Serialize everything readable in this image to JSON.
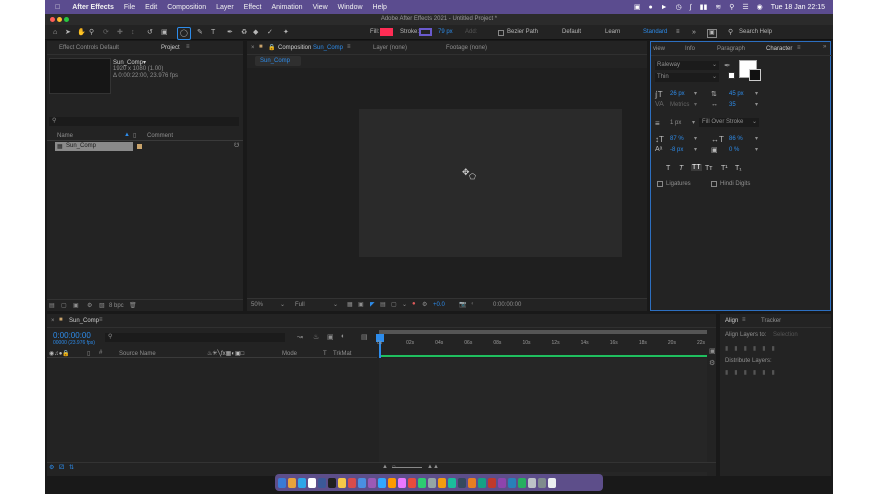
{
  "menubar": {
    "app": "After Effects",
    "items": [
      "File",
      "Edit",
      "Composition",
      "Layer",
      "Effect",
      "Animation",
      "View",
      "Window",
      "Help"
    ],
    "clock": "Tue 18 Jan  22:15"
  },
  "window": {
    "title": "Adobe After Effects 2021 - Untitled Project *"
  },
  "toolbar": {
    "fill_label": "Fill:",
    "fill_color": "#ff2d55",
    "stroke_label": "Stroke:",
    "stroke_color": "#6a5acd",
    "stroke_width": "79 px",
    "add_label": "Add:",
    "bezier_label": "Bezier Path",
    "workspaces": [
      "Default",
      "Learn",
      "Standard"
    ],
    "search_help": "Search Help"
  },
  "project": {
    "tabs": [
      "Effect Controls Default",
      "Project"
    ],
    "selected": {
      "name": "Sun_Comp▾",
      "resolution": "1920 x 1080 (1.00)",
      "duration": "Δ 0:00:22:00, 23.976 fps"
    },
    "columns": [
      "Name",
      "Comment"
    ],
    "items": [
      {
        "name": "Sun_Comp"
      }
    ],
    "bit_depth": "8 bpc"
  },
  "viewer": {
    "tab_prefix": "Composition",
    "comp_name": "Sun_Comp",
    "layer_tab": "Layer (none)",
    "footage_tab": "Footage (none)",
    "breadcrumb": "Sun_Comp",
    "zoom": "50%",
    "resolution": "Full",
    "exposure": "+0.0",
    "timecode": "0:00:00:00"
  },
  "character": {
    "tabs": [
      "view",
      "Info",
      "Paragraph",
      "Character"
    ],
    "font_family": "Raleway",
    "font_style": "Thin",
    "font_size": "26 px",
    "leading": "45 px",
    "kerning": "Metrics",
    "tracking": "35",
    "stroke_width": "1 px",
    "stroke_type": "Fill Over Stroke",
    "vertical_scale": "87 %",
    "horizontal_scale": "86 %",
    "baseline_shift": "-8 px",
    "tsume": "0 %",
    "ligatures": "Ligatures",
    "hindi_digits": "Hindi Digits"
  },
  "timeline": {
    "tab": "Sun_Comp",
    "current_time": "0:00:00:00",
    "frame_info": "00000 (23.976 fps)",
    "columns": [
      "#",
      "Source Name",
      "Mode",
      "TrkMat"
    ],
    "ruler": [
      "0s",
      "02s",
      "04s",
      "06s",
      "08s",
      "10s",
      "12s",
      "14s",
      "16s",
      "18s",
      "20s",
      "22s"
    ]
  },
  "align": {
    "tabs": [
      "Align",
      "Tracker"
    ],
    "align_to_label": "Align Layers to:",
    "align_to_value": "Selection",
    "distribute_label": "Distribute Layers:"
  }
}
